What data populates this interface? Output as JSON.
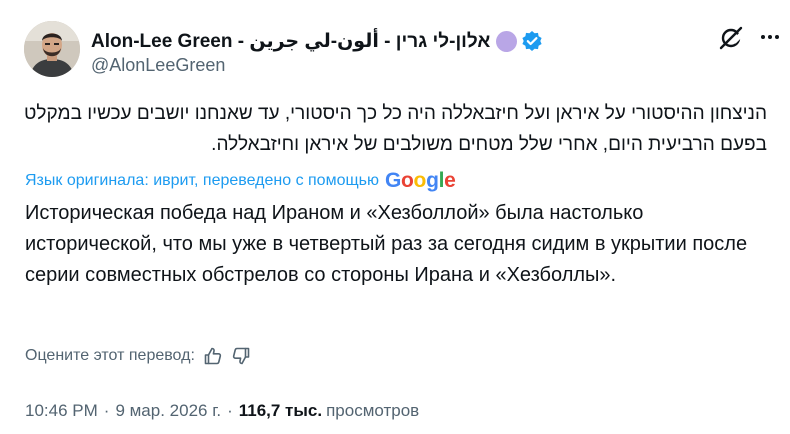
{
  "author": {
    "display_name": "Alon-Lee Green - אלון-לי גרין - ألون-لي جرين",
    "handle": "@AlonLeeGreen",
    "verified": true,
    "avatar": "profile-photo",
    "accent_color": "#1d9bf0"
  },
  "header_icons": {
    "grok": "grok-icon",
    "more": "more-horizontal-icon"
  },
  "post": {
    "original_text": "הניצחון ההיסטורי על איראן ועל חיזבאללה היה כל כך היסטורי, עד שאנחנו יושבים עכשיו במקלט בפעם הרביעית היום, אחרי שלל מטחים משולבים של איראן וחיזבאללה.",
    "translation_notice": "Язык оригинала: иврит, переведено с помощью",
    "translation_provider": "Google",
    "translated_text": "Историческая победа над Ираном и «Хезболлой» была настолько исторической, что мы уже в четвертый раз за сегодня сидим в укрытии после серии совместных обстрелов со стороны Ирана и «Хезболлы»."
  },
  "rating": {
    "label": "Оцените этот перевод:",
    "thumbs_up": "thumbs-up-icon",
    "thumbs_down": "thumbs-down-icon"
  },
  "meta": {
    "time": "10:46 PM",
    "separator": "·",
    "date": "9 мар. 2026 г.",
    "views_count": "116,7 тыс.",
    "views_label": "просмотров"
  }
}
